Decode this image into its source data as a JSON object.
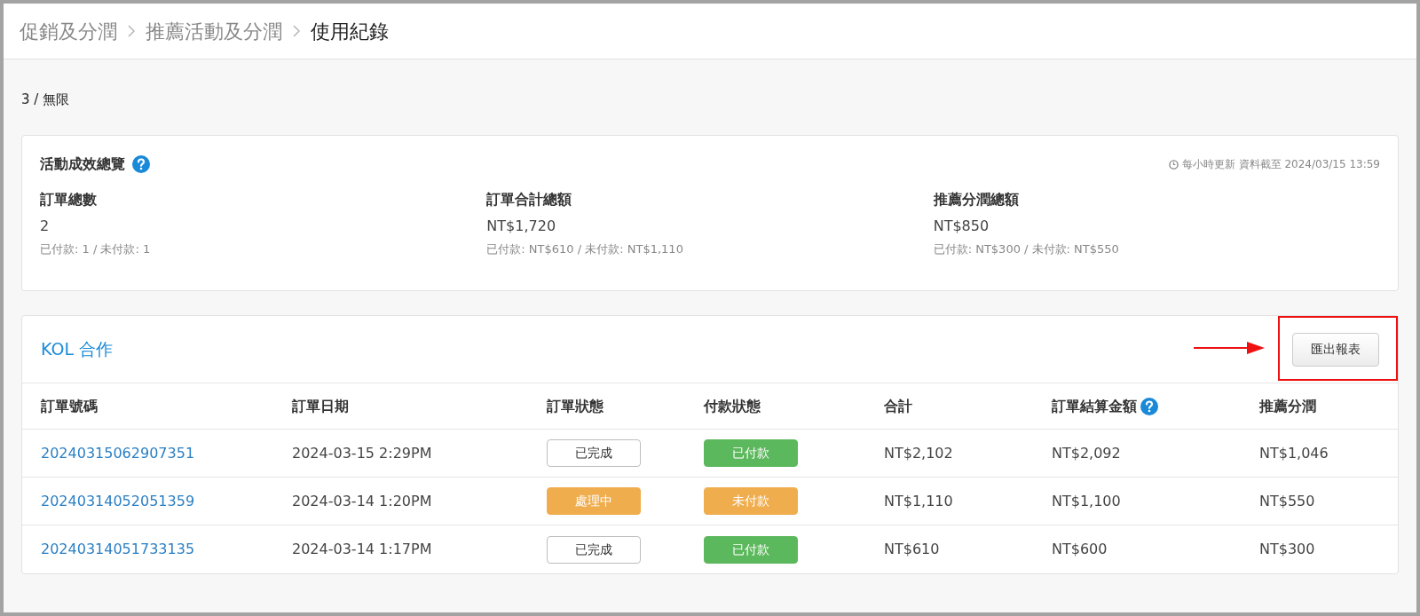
{
  "breadcrumb": [
    {
      "label": "促銷及分潤",
      "current": false
    },
    {
      "label": "推薦活動及分潤",
      "current": false
    },
    {
      "label": "使用紀錄",
      "current": true
    }
  ],
  "usage": "3 / 無限",
  "overview": {
    "title": "活動成效總覽",
    "updated": "每小時更新 資料截至 2024/03/15 13:59",
    "stats": [
      {
        "label": "訂單總數",
        "value": "2",
        "detail": "已付款: 1 / 未付款: 1"
      },
      {
        "label": "訂單合計總額",
        "value": "NT$1,720",
        "detail": "已付款: NT$610 / 未付款: NT$1,110"
      },
      {
        "label": "推薦分潤總額",
        "value": "NT$850",
        "detail": "已付款: NT$300 / 未付款: NT$550"
      }
    ]
  },
  "orders": {
    "title": "KOL 合作",
    "export_button": "匯出報表",
    "columns": [
      {
        "label": "訂單號碼"
      },
      {
        "label": "訂單日期"
      },
      {
        "label": "訂單狀態"
      },
      {
        "label": "付款狀態"
      },
      {
        "label": "合計"
      },
      {
        "label": "訂單結算金額",
        "help": true
      },
      {
        "label": "推薦分潤"
      }
    ],
    "rows": [
      {
        "order_no": "20240315062907351",
        "date": "2024-03-15 2:29PM",
        "order_status": {
          "label": "已完成",
          "kind": "outline"
        },
        "payment_status": {
          "label": "已付款",
          "kind": "success"
        },
        "total": "NT$2,102",
        "settlement": "NT$2,092",
        "commission": "NT$1,046"
      },
      {
        "order_no": "20240314052051359",
        "date": "2024-03-14 1:20PM",
        "order_status": {
          "label": "處理中",
          "kind": "warning"
        },
        "payment_status": {
          "label": "未付款",
          "kind": "warning"
        },
        "total": "NT$1,110",
        "settlement": "NT$1,100",
        "commission": "NT$550"
      },
      {
        "order_no": "20240314051733135",
        "date": "2024-03-14 1:17PM",
        "order_status": {
          "label": "已完成",
          "kind": "outline"
        },
        "payment_status": {
          "label": "已付款",
          "kind": "success"
        },
        "total": "NT$610",
        "settlement": "NT$600",
        "commission": "NT$300"
      }
    ]
  }
}
